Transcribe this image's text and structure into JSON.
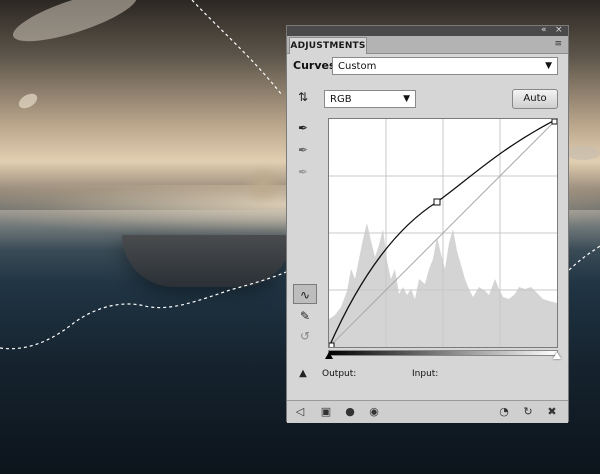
{
  "panel": {
    "tab_label": "ADJUSTMENTS",
    "preset_label": "Curves",
    "preset_value": "Custom",
    "channel_value": "RGB",
    "auto_label": "Auto",
    "output_label": "Output:",
    "input_label": "Input:"
  },
  "icons": {
    "collapse": "«",
    "close": "×",
    "panel_menu": "≡",
    "dropdown": "▼",
    "on_image_adjust": "⇅",
    "eyedropper": "✒",
    "curve_tool": "∿",
    "pencil": "✎",
    "smooth": "↺",
    "clip_warning": "▲",
    "footer": [
      "◁",
      "▣",
      "●",
      "◉",
      "◔",
      "↻",
      "✖"
    ]
  },
  "colors": {
    "panel_bg": "#d6d6d6",
    "titlebar": "#4a4a4a",
    "curve": "#111111"
  }
}
